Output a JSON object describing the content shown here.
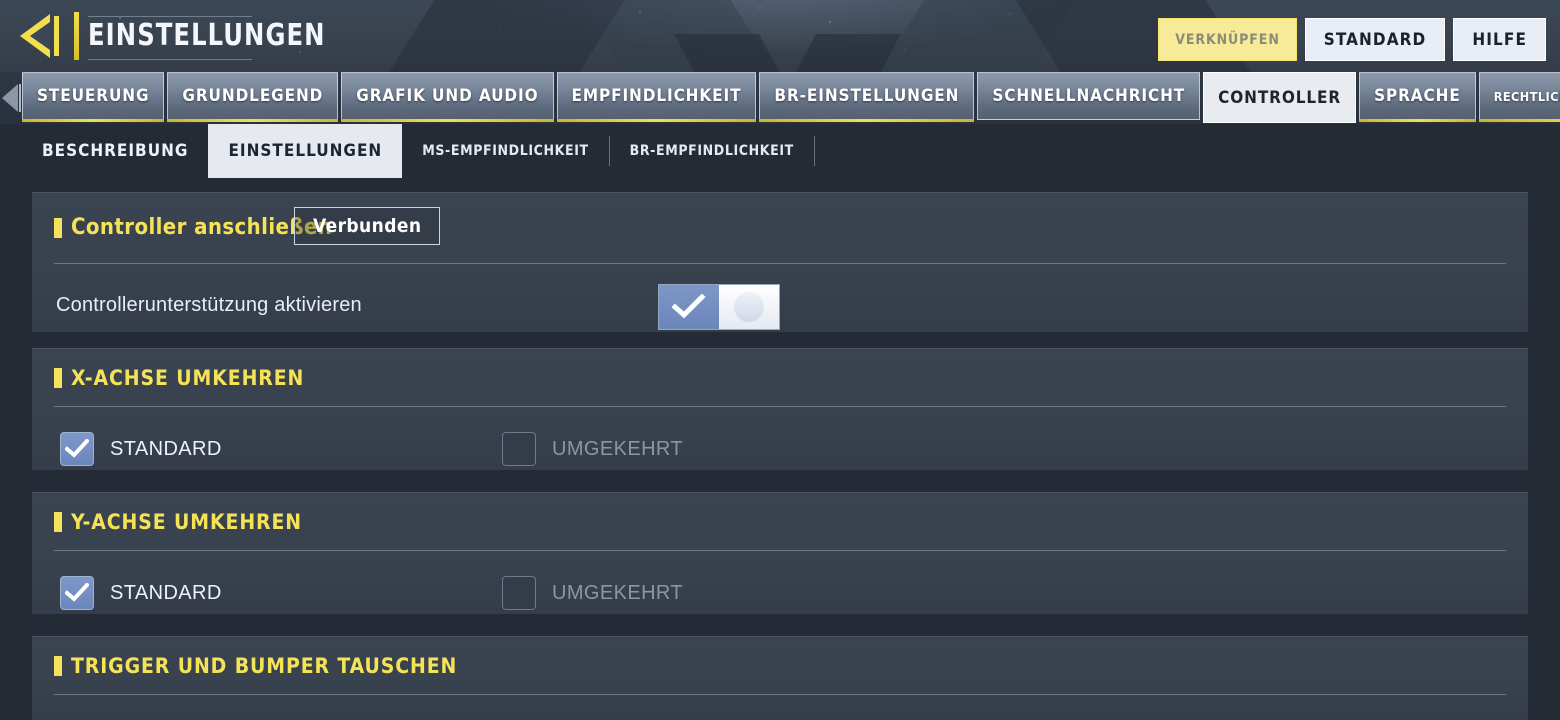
{
  "header": {
    "back_icon": "back-arrow-icon",
    "title": "EINSTELLUNGEN",
    "buttons": [
      {
        "label": "VERKNÜPFEN",
        "style": "yellow"
      },
      {
        "label": "STANDARD",
        "style": "light"
      },
      {
        "label": "HILFE",
        "style": "light"
      }
    ]
  },
  "nav": {
    "prev_icon": "chevron-left-icon",
    "next_icon": "chevron-right-icon",
    "tabs": [
      {
        "label": "STEUERUNG",
        "active": false
      },
      {
        "label": "GRUNDLEGEND",
        "active": false
      },
      {
        "label": "GRAFIK UND AUDIO",
        "active": false
      },
      {
        "label": "EMPFINDLICHKEIT",
        "active": false
      },
      {
        "label": "BR-EINSTELLUNGEN",
        "active": false
      },
      {
        "label": "SCHNELLNACHRICHT",
        "active": false
      },
      {
        "label": "CONTROLLER",
        "active": true
      },
      {
        "label": "SPRACHE",
        "active": false
      },
      {
        "label": "RECHTLICHES UND DATENSCHUTZ",
        "active": false
      }
    ]
  },
  "subtabs": [
    {
      "label": "BESCHREIBUNG",
      "active": false
    },
    {
      "label": "EINSTELLUNGEN",
      "active": true
    },
    {
      "label": "MS-EMPFINDLICHKEIT",
      "active": false
    },
    {
      "label": "BR-EMPFINDLICHKEIT",
      "active": false
    }
  ],
  "sections": {
    "connect": {
      "title": "Controller anschließen",
      "status_button": "Verbunden",
      "support_label": "Controllerunterstützung aktivieren",
      "toggle_state": "on",
      "toggle_check_icon": "checkmark-icon"
    },
    "invert_x": {
      "title": "X-ACHSE UMKEHREN",
      "options": [
        {
          "label": "STANDARD",
          "checked": true
        },
        {
          "label": "UMGEKEHRT",
          "checked": false
        }
      ]
    },
    "invert_y": {
      "title": "Y-ACHSE UMKEHREN",
      "options": [
        {
          "label": "STANDARD",
          "checked": true
        },
        {
          "label": "UMGEKEHRT",
          "checked": false
        }
      ]
    },
    "swap_triggers": {
      "title": "TRIGGER UND BUMPER TAUSCHEN"
    }
  },
  "colors": {
    "accent_yellow": "#f5e357",
    "checkbox_blue": "#6f89bd",
    "panel_bg": "#39424f",
    "page_bg": "#242b35"
  }
}
